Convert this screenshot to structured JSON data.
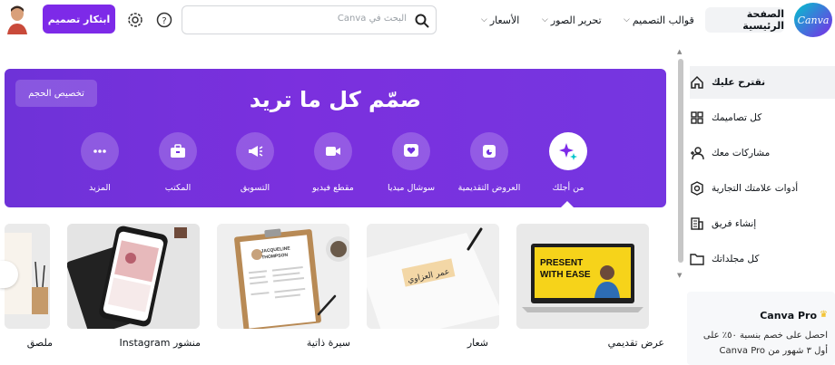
{
  "header": {
    "logo_text": "Canva",
    "nav": {
      "home": "الصفحة الرئيسية",
      "templates": "قوالب التصميم",
      "photo_edit": "تحرير الصور",
      "pricing": "الأسعار"
    },
    "search_placeholder": "البحث في Canva",
    "create_button": "ابتكار تصميم",
    "icons": [
      "help-icon",
      "settings-icon",
      "search-icon",
      "chevron-down-icon"
    ]
  },
  "sidebar": {
    "items": [
      {
        "label": "نقترح عليك",
        "icon": "home-icon",
        "active": true
      },
      {
        "label": "كل تصاميمك",
        "icon": "grid-icon",
        "active": false
      },
      {
        "label": "مشاركات معك",
        "icon": "people-icon",
        "active": false
      },
      {
        "label": "أدوات علامتك التجارية",
        "icon": "brand-icon",
        "active": false
      },
      {
        "label": "إنشاء فريق",
        "icon": "building-icon",
        "active": false
      },
      {
        "label": "كل مجلداتك",
        "icon": "folder-icon",
        "active": false
      }
    ],
    "pro": {
      "title": "Canva Pro",
      "text": "احصل على خصم بنسبة ٥٠٪ على أول ٣ شهور من Canva Pro"
    }
  },
  "banner": {
    "title": "صمّم كل ما تريد",
    "custom_size": "تخصيص الحجم",
    "categories": [
      {
        "label": "من أجلك",
        "icon": "sparkle-icon",
        "active": true
      },
      {
        "label": "العروض التقديمية",
        "icon": "presentation-icon",
        "active": false
      },
      {
        "label": "سوشال ميديا",
        "icon": "heart-icon",
        "active": false
      },
      {
        "label": "مقطع فيديو",
        "icon": "video-icon",
        "active": false
      },
      {
        "label": "التسويق",
        "icon": "megaphone-icon",
        "active": false
      },
      {
        "label": "المكتب",
        "icon": "briefcase-icon",
        "active": false
      },
      {
        "label": "المزيد",
        "icon": "more-icon",
        "active": false
      }
    ]
  },
  "templates": [
    {
      "label": "عرض تقديمي",
      "preview_text": "PRESENT WITH EASE"
    },
    {
      "label": "شعار",
      "preview_text": "عمر العزاوي"
    },
    {
      "label": "سيرة ذاتية",
      "preview_text": "JACQUELINE THOMPSON"
    },
    {
      "label": "منشور Instagram",
      "preview_text": ""
    },
    {
      "label": "ملصق",
      "preview_text": ""
    }
  ],
  "colors": {
    "accent": "#7d2ae8",
    "banner": "#7030de",
    "present_yellow": "#f6d31a"
  }
}
